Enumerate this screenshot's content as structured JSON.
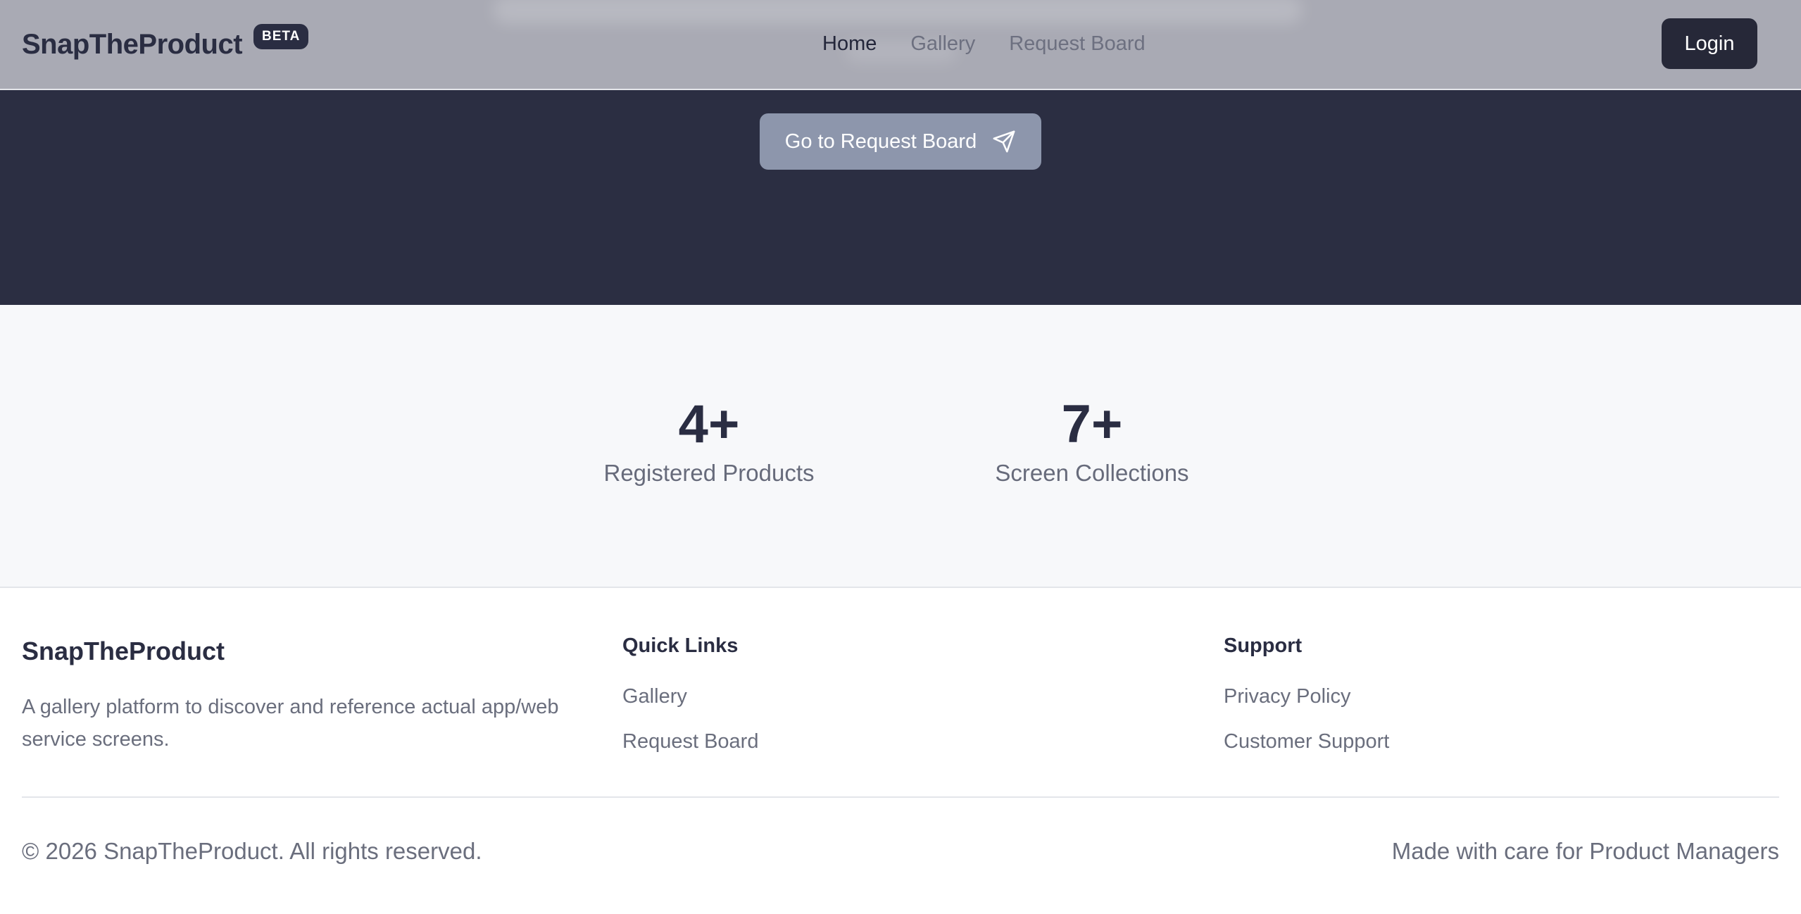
{
  "header": {
    "brand": "SnapTheProduct",
    "badge": "BETA",
    "nav": {
      "home": "Home",
      "gallery": "Gallery",
      "request_board": "Request Board"
    },
    "login_label": "Login"
  },
  "hero": {
    "cta_label": "Go to Request Board",
    "cta_icon": "send-icon"
  },
  "stats": {
    "products": {
      "value": "4+",
      "label": "Registered Products"
    },
    "collections": {
      "value": "7+",
      "label": "Screen Collections"
    }
  },
  "footer": {
    "brand": "SnapTheProduct",
    "description": "A gallery platform to discover and reference actual app/web service screens.",
    "quick_links": {
      "heading": "Quick Links",
      "items": [
        "Gallery",
        "Request Board"
      ]
    },
    "support": {
      "heading": "Support",
      "items": [
        "Privacy Policy",
        "Customer Support"
      ]
    },
    "copyright": "© 2026 SnapTheProduct. All rights reserved.",
    "tagline": "Made with care for Product Managers"
  },
  "colors": {
    "primary_dark": "#2b2e42",
    "header_overlay": "#a9aab4",
    "cta_button": "#8d96ac",
    "stats_background": "#f7f8fa",
    "muted_text": "#6a6e7d"
  }
}
